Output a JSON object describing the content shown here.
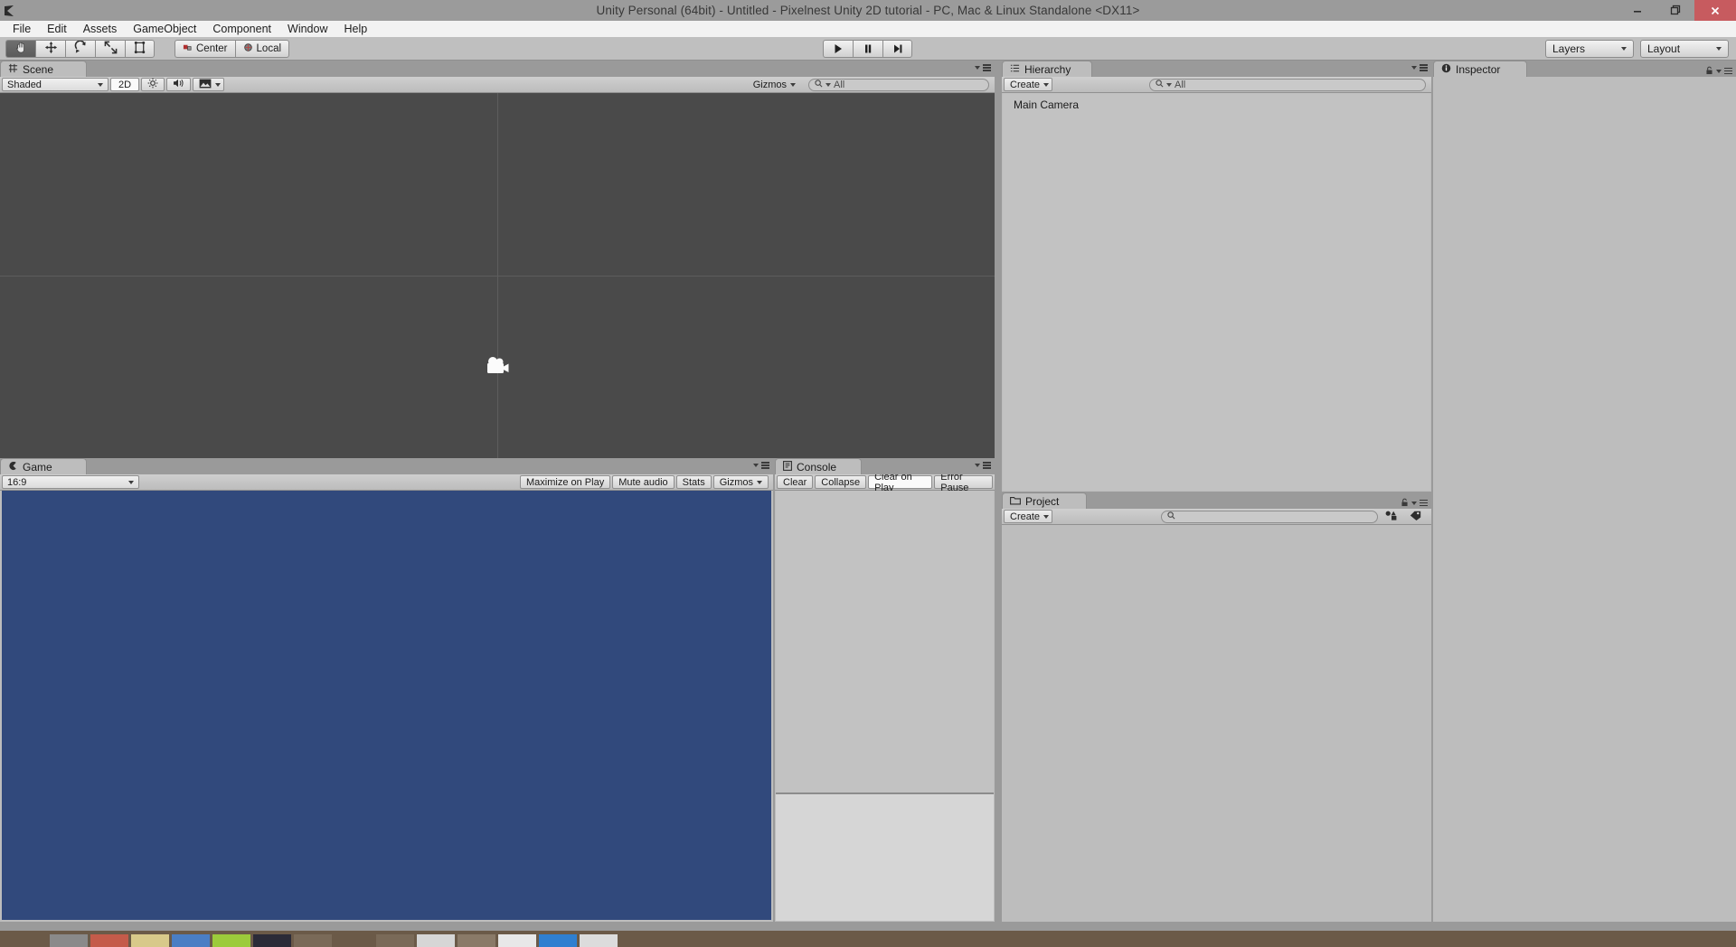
{
  "window": {
    "title": "Unity Personal (64bit) - Untitled - Pixelnest Unity 2D tutorial - PC, Mac & Linux Standalone <DX11>",
    "logo_icon": "unity-logo-icon",
    "minimize_label": "–",
    "restore_label": "❐",
    "close_label": "✕"
  },
  "menubar": {
    "items": [
      {
        "label": "File"
      },
      {
        "label": "Edit"
      },
      {
        "label": "Assets"
      },
      {
        "label": "GameObject"
      },
      {
        "label": "Component"
      },
      {
        "label": "Window"
      },
      {
        "label": "Help"
      }
    ]
  },
  "toolbar": {
    "tools": [
      {
        "name": "hand-tool",
        "icon": "hand-icon",
        "active": true
      },
      {
        "name": "move-tool",
        "icon": "move-icon",
        "active": false
      },
      {
        "name": "rotate-tool",
        "icon": "rotate-icon",
        "active": false
      },
      {
        "name": "scale-tool",
        "icon": "scale-icon",
        "active": false
      },
      {
        "name": "rect-tool",
        "icon": "rect-transform-icon",
        "active": false
      }
    ],
    "pivot_label": "Center",
    "pivot_icon": "pivot-center-icon",
    "rotation_label": "Local",
    "rotation_icon": "rotation-local-icon",
    "play_label": "▶",
    "pause_label": "❚❚",
    "step_label": "▶❙",
    "layers_label": "Layers",
    "layout_label": "Layout"
  },
  "scene": {
    "tab_label": "Scene",
    "tab_icon": "scene-grid-icon",
    "shading_mode": "Shaded",
    "mode_2d_label": "2D",
    "lighting_icon": "lighting-sun-icon",
    "audio_icon": "audio-speaker-icon",
    "effects_icon": "effects-image-icon",
    "gizmos_label": "Gizmos",
    "search_placeholder": "All",
    "search_icon": "search-icon",
    "camera_gizmo": "main-camera-gizmo-icon",
    "background_color": "#4a4a4a",
    "grid_color": "#5d5d5d"
  },
  "game": {
    "tab_label": "Game",
    "tab_icon": "game-view-icon",
    "aspect_ratio": "16:9",
    "maximize_label": "Maximize on Play",
    "mute_label": "Mute audio",
    "stats_label": "Stats",
    "gizmos_label": "Gizmos",
    "background_color": "#31497c"
  },
  "console": {
    "tab_label": "Console",
    "tab_icon": "console-icon",
    "clear_label": "Clear",
    "collapse_label": "Collapse",
    "clear_on_play_label": "Clear on Play",
    "error_pause_label": "Error Pause"
  },
  "hierarchy": {
    "tab_label": "Hierarchy",
    "tab_icon": "hierarchy-list-icon",
    "create_label": "Create",
    "search_placeholder": "All",
    "search_icon": "search-icon",
    "items": [
      {
        "label": "Main Camera"
      }
    ]
  },
  "project": {
    "tab_label": "Project",
    "tab_icon": "project-folder-icon",
    "create_label": "Create",
    "search_placeholder": "",
    "search_icon": "search-icon",
    "filter_type_icon": "filter-by-type-icon",
    "filter_label_icon": "filter-by-label-icon",
    "lock_icon": "lock-icon"
  },
  "inspector": {
    "tab_label": "Inspector",
    "tab_icon": "inspector-info-icon",
    "lock_icon": "lock-icon"
  },
  "taskbar": {
    "background_color": "#6b5a48"
  }
}
